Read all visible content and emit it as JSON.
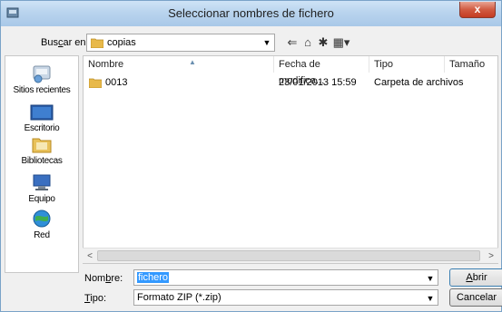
{
  "window": {
    "title": "Seleccionar nombres de fichero",
    "close_glyph": "x"
  },
  "lookin": {
    "label_pre": "Bus",
    "label_accel": "c",
    "label_post": "ar en:",
    "value": "copias"
  },
  "toolbar": {
    "back_glyph": "⇐",
    "up_glyph": "⌂",
    "newfolder_glyph": "✱",
    "views_glyph": "▦▾"
  },
  "places": [
    {
      "label": "Sitios recientes",
      "icon": "recent-places-icon"
    },
    {
      "label": "Escritorio",
      "icon": "desktop-icon"
    },
    {
      "label": "Bibliotecas",
      "icon": "libraries-icon"
    },
    {
      "label": "Equipo",
      "icon": "computer-icon"
    },
    {
      "label": "Red",
      "icon": "network-icon"
    }
  ],
  "columns": [
    "Nombre",
    "Fecha de modifica...",
    "Tipo",
    "Tamaño"
  ],
  "files": [
    {
      "name": "0013",
      "date": "23/01/2013 15:59",
      "type": "Carpeta de archivos",
      "size": ""
    }
  ],
  "filename": {
    "label_pre": "Nom",
    "label_accel": "b",
    "label_post": "re:",
    "value": "fichero"
  },
  "filetype": {
    "label_accel": "T",
    "label_post": "ipo:",
    "value": "Formato ZIP (*.zip)"
  },
  "buttons": {
    "open_accel": "A",
    "open_post": "brir",
    "cancel": "Cancelar"
  },
  "colors": {
    "titlebar": "#b9d4ee",
    "selection": "#3399ff",
    "close": "#c43c22",
    "folder": "#e8b94a"
  }
}
